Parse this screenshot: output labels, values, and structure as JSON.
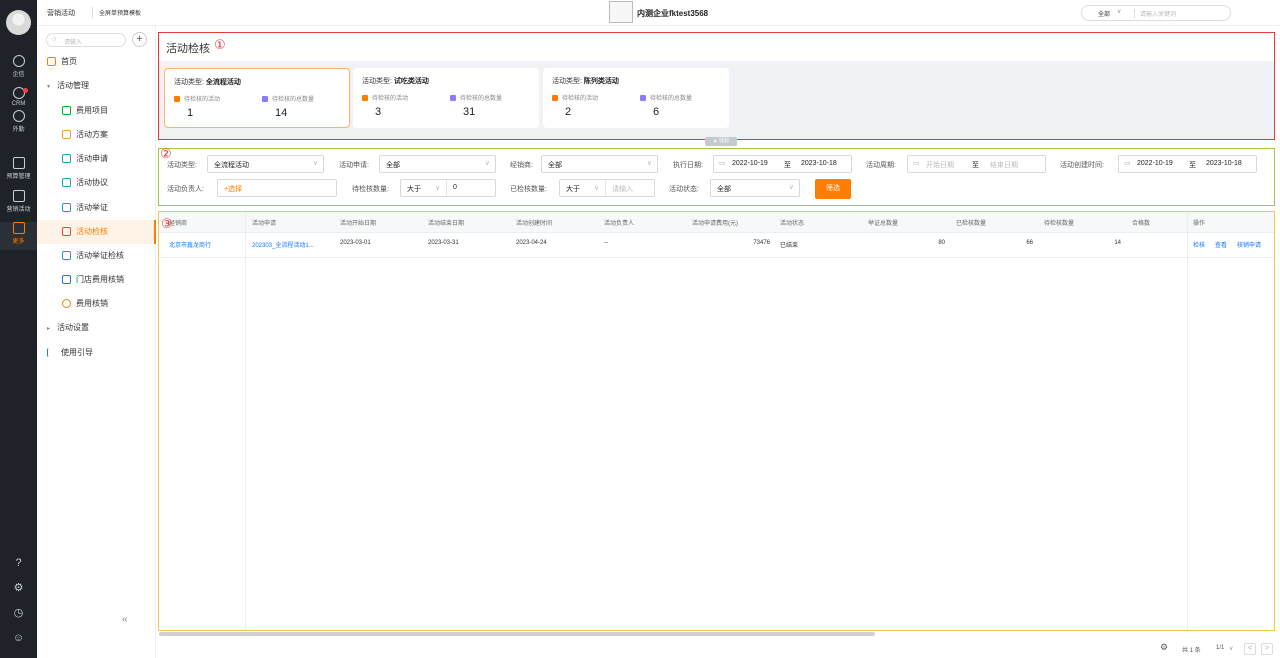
{
  "rail": {
    "items": [
      {
        "label": "企信",
        "icon": "chat-icon"
      },
      {
        "label": "CRM",
        "icon": "crm-icon"
      },
      {
        "label": "外勤",
        "icon": "location-icon"
      },
      {
        "label": "预算管理",
        "icon": "budget-icon"
      },
      {
        "label": "营销活动",
        "icon": "clipboard-icon"
      },
      {
        "label": "更多",
        "icon": "grid-icon"
      }
    ],
    "bottom_icons": [
      "help-icon",
      "settings-icon",
      "clock-icon",
      "contacts-icon"
    ]
  },
  "header": {
    "breadcrumb_1": "营销活动",
    "breadcrumb_2": "全屏单预算模板",
    "company": "内测企业fktest3568",
    "search_scope": "全部",
    "search_placeholder": "请输入关键词"
  },
  "sidebar": {
    "search_placeholder": "请输入",
    "add": "+",
    "items": [
      {
        "label": "首页",
        "level": 1
      },
      {
        "label": "活动管理",
        "level": 1,
        "expanded": true
      },
      {
        "label": "费用项目",
        "level": 2
      },
      {
        "label": "活动方案",
        "level": 2
      },
      {
        "label": "活动申请",
        "level": 2
      },
      {
        "label": "活动协议",
        "level": 2
      },
      {
        "label": "活动举证",
        "level": 2
      },
      {
        "label": "活动检核",
        "level": 2,
        "active": true
      },
      {
        "label": "活动举证检核",
        "level": 2
      },
      {
        "label": "门店费用核销",
        "level": 2
      },
      {
        "label": "费用核销",
        "level": 2
      },
      {
        "label": "活动设置",
        "level": 1,
        "expanded": false
      },
      {
        "label": "使用引导",
        "level": 1
      }
    ],
    "collapse": "«"
  },
  "annotations": {
    "one": "①",
    "two": "②",
    "three": "③"
  },
  "stats": {
    "title": "活动检核",
    "type_prefix": "活动类型:",
    "metric_pending": "待检核的活动",
    "metric_total": "待检核的总数量",
    "cards": [
      {
        "type": "全流程活动",
        "pending": "1",
        "total": "14",
        "selected": true
      },
      {
        "type": "试吃类活动",
        "pending": "3",
        "total": "31",
        "selected": false
      },
      {
        "type": "陈列类活动",
        "pending": "2",
        "total": "6",
        "selected": false
      }
    ],
    "collapse_label": "▲ 收起"
  },
  "filters": {
    "activity_type": {
      "label": "活动类型:",
      "value": "全流程活动"
    },
    "activity_application": {
      "label": "活动申请:",
      "value": "全部"
    },
    "dealer": {
      "label": "经销商:",
      "value": "全部"
    },
    "exec_date": {
      "label": "执行日期:",
      "start": "2022-10-19",
      "to": "至",
      "end": "2023-10-18"
    },
    "period": {
      "label": "活动周期:",
      "start_ph": "开始日期",
      "to": "至",
      "end_ph": "结束日期"
    },
    "create_time": {
      "label": "活动创建时间:",
      "start": "2022-10-19",
      "to": "至",
      "end": "2023-10-18"
    },
    "owner": {
      "label": "活动负责人:",
      "value": "+选择"
    },
    "pending_count": {
      "label": "待检核数量:",
      "op": "大于",
      "value": "0"
    },
    "checked_count": {
      "label": "已检核数量:",
      "op": "大于",
      "value_ph": "请输入"
    },
    "status": {
      "label": "活动状态:",
      "value": "全部"
    },
    "submit": "筛选"
  },
  "table": {
    "columns": [
      "经销商",
      "活动申请",
      "活动开始日期",
      "活动结束日期",
      "活动创建时间",
      "活动负责人",
      "活动申请费用(元)",
      "活动状态",
      "举证总数量",
      "已检核数量",
      "待检核数量",
      "合格数",
      "操作"
    ],
    "rows": [
      {
        "dealer": "北京市鑫龙商行",
        "application": "202303_全流程活动1...",
        "start": "2023-03-01",
        "end": "2023-03-31",
        "created": "2023-04-24",
        "owner": "--",
        "fee": "73476",
        "status": "已结束",
        "proof_total": "80",
        "checked": "66",
        "pending": "14",
        "qualified": "",
        "actions": [
          "检核",
          "查看",
          "核销申请"
        ]
      }
    ]
  },
  "footer": {
    "total": "共 1 条",
    "pages": "1/1",
    "prev": "<",
    "next": ">"
  },
  "colors": {
    "accent": "#ff7d00",
    "link": "#1677ff",
    "frame_1": "#e53935",
    "frame_2": "#9ccc3c",
    "frame_3": "#f2c94c"
  }
}
